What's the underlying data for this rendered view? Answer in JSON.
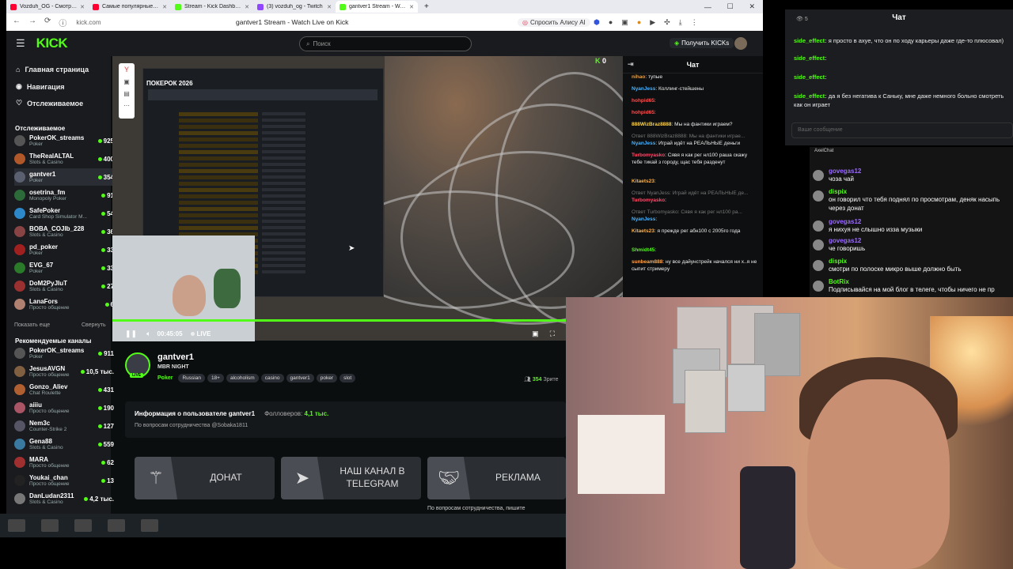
{
  "browser": {
    "tabs": [
      {
        "title": "Vozduh_OG - Смотрите в",
        "color": "#ff0033",
        "active": false
      },
      {
        "title": "Самые популярные трен",
        "color": "#ff0033",
        "active": false
      },
      {
        "title": "Stream - Kick Dashboard",
        "color": "#53fc18",
        "active": false
      },
      {
        "title": "(3) vozduh_og - Twitch",
        "color": "#9146ff",
        "active": false
      },
      {
        "title": "gantver1 Stream - Watc",
        "color": "#53fc18",
        "active": true
      }
    ],
    "url": "kick.com",
    "page_title": "gantver1 Stream - Watch Live on Kick",
    "alice": "Спросить Алису AI"
  },
  "kick": {
    "logo": "KICK",
    "search_placeholder": "Поиск",
    "get_kicks": "Получить KICKs",
    "sidebar": {
      "nav": [
        "Главная страница",
        "Навигация",
        "Отслеживаемое"
      ],
      "followed_title": "Отслеживаемое",
      "followed": [
        {
          "name": "PokerOK_streams",
          "cat": "Poker",
          "viewers": "925",
          "color": "#555"
        },
        {
          "name": "TheRealALTAL",
          "cat": "Slots & Casino",
          "viewers": "400",
          "color": "#b0582a"
        },
        {
          "name": "gantver1",
          "cat": "Poker",
          "viewers": "354",
          "color": "#5b6070"
        },
        {
          "name": "osetrina_fm",
          "cat": "Monopoly Poker",
          "viewers": "91",
          "color": "#2d6a3a"
        },
        {
          "name": "SafePoker",
          "cat": "Card Shop Simulator M...",
          "viewers": "54",
          "color": "#2d88c9"
        },
        {
          "name": "BOBA_COJIb_228",
          "cat": "Slots & Casino",
          "viewers": "36",
          "color": "#884444"
        },
        {
          "name": "pd_poker",
          "cat": "Poker",
          "viewers": "33",
          "color": "#a02020"
        },
        {
          "name": "EVG_67",
          "cat": "Poker",
          "viewers": "33",
          "color": "#2a7a2a"
        },
        {
          "name": "DoM2PyJIuT",
          "cat": "Slots & Casino",
          "viewers": "27",
          "color": "#9a3030"
        },
        {
          "name": "LanaFors",
          "cat": "Просто общение",
          "viewers": "6",
          "color": "#b08070"
        }
      ],
      "show_more": "Показать еще",
      "collapse": "Свернуть",
      "recommended_title": "Рекомендуемые каналы",
      "recommended": [
        {
          "name": "PokerOK_streams",
          "cat": "Poker",
          "viewers": "911",
          "color": "#555"
        },
        {
          "name": "JesusAVGN",
          "cat": "Просто общение",
          "viewers": "10,5 тыс.",
          "color": "#806040"
        },
        {
          "name": "Gonzo_Aliev",
          "cat": "Chat Roulette",
          "viewers": "431",
          "color": "#b06030"
        },
        {
          "name": "aiiiu",
          "cat": "Просто общение",
          "viewers": "190",
          "color": "#aa5566"
        },
        {
          "name": "Nem3c",
          "cat": "Counter-Strike 2",
          "viewers": "127",
          "color": "#556"
        },
        {
          "name": "Gena88",
          "cat": "Slots & Casino",
          "viewers": "559",
          "color": "#3a7aa0"
        },
        {
          "name": "MARA",
          "cat": "Просто общение",
          "viewers": "62",
          "color": "#a03030"
        },
        {
          "name": "Youkai_chan",
          "cat": "Просто общение",
          "viewers": "13",
          "color": "#222"
        },
        {
          "name": "DanLudan2311",
          "cat": "Slots & Casino",
          "viewers": "4,2 тыс.",
          "color": "#777"
        }
      ]
    },
    "player": {
      "overlay_title": "ПОКЕРОК 2026",
      "overlay_count": "0",
      "time": "00:45:05",
      "live": "LIVE"
    },
    "channel": {
      "name": "gantver1",
      "stream_title": "MBR NIGHT",
      "category": "Poker",
      "tags": [
        "Russian",
        "18+",
        "alcoholism",
        "casino",
        "gantver1",
        "poker",
        "slot"
      ],
      "viewers": "354",
      "viewers_label": "Зрите",
      "live_badge": "LIVE",
      "about_title": "Информация о пользователе gantver1",
      "followers_label": "Фолловеров:",
      "followers": "4,1 тыс.",
      "about_desc": "По вопросам сотрудничества @Sobaka1811",
      "panels": [
        "ДОНАТ",
        "НАШ КАНАЛ В TELEGRAM",
        "РЕКЛАМА"
      ],
      "panel_note": "По вопросам сотрудничества, пишите"
    },
    "chat": {
      "title": "Чат",
      "messages": [
        {
          "user": "nihao",
          "color": "#e0a050",
          "text": "тупые",
          "reply": ""
        },
        {
          "user": "NyanJess",
          "color": "#4ab3ff",
          "text": "Коллинг-стейшены",
          "reply": ""
        },
        {
          "user": "hohpid65",
          "color": "#ff5050",
          "text": "",
          "reply": ""
        },
        {
          "user": "hohpid65",
          "color": "#ff5050",
          "text": "",
          "reply": ""
        },
        {
          "user": "888WizBraz8888",
          "color": "#ffd34a",
          "text": "Мы на фантики играем?",
          "reply": ""
        },
        {
          "user": "NyanJess",
          "color": "#4ab3ff",
          "text": "Играй идёт на РЕАЛЬНЫЕ деньги",
          "reply": "Ответ 888WizBraz8888: Мы на фантики играе..."
        },
        {
          "user": "Turbomyasko",
          "color": "#ff4d6d",
          "text": "Сявя я как рег нл100 раша скажу тебе тикай з городу, щас тебя разденут",
          "reply": ""
        },
        {
          "user": "Kitaets23",
          "color": "#ffb04a",
          "text": "",
          "reply": ""
        },
        {
          "user": "Turbomyasko",
          "color": "#ff4d6d",
          "text": "",
          "reply": "Ответ NyanJess: Играй идёт на РЕАЛЬНЫЕ де..."
        },
        {
          "user": "NyanJess",
          "color": "#4ab3ff",
          "text": "",
          "reply": "Ответ Turbomyasko: Сявя я как рег нл100 ра..."
        },
        {
          "user": "Kitaets23",
          "color": "#ffb04a",
          "text": "я прежде рег абн100 с 2005го года",
          "reply": ""
        },
        {
          "user": "Shmidt45",
          "color": "#53fc18",
          "text": "",
          "reply": ""
        },
        {
          "user": "sunbeam888",
          "color": "#ffa94d",
          "text": "ну все дайунстрейк начался ни х..я не сыпит стримеру",
          "reply": ""
        }
      ]
    }
  },
  "right_chat": {
    "title": "Чат",
    "viewers": "5",
    "messages": [
      {
        "user": "side_effect:",
        "text": "я просто в ахуе, что он по ходу карьеры даже где-то плюсовал)"
      },
      {
        "user": "side_effect:",
        "text": ""
      },
      {
        "user": "side_effect:",
        "text": ""
      },
      {
        "user": "side_effect:",
        "text": "да я без негатива к Саньку, мне даже немного больно смотреть как он играет"
      }
    ],
    "input_placeholder": "Ваше сообщение"
  },
  "axel_chat": {
    "title": "AxelChat",
    "messages": [
      {
        "user": "govegas12",
        "color": "#9a6aff",
        "text": "чоза чай"
      },
      {
        "user": "dispix",
        "color": "#53fc18",
        "text": "он говорил что тебя поднял по просмотрам, деняк насыпь через донат"
      },
      {
        "user": "govegas12",
        "color": "#9a6aff",
        "text": "я нихуя не слышно изза музыки"
      },
      {
        "user": "govegas12",
        "color": "#9a6aff",
        "text": "че говоришь"
      },
      {
        "user": "dispix",
        "color": "#53fc18",
        "text": "смотри по полоске микро выше должно быть"
      },
      {
        "user": "BotRix",
        "color": "#53fc18",
        "text": "Подписывайся на мой блог в телеге, чтобы ничего не пр"
      }
    ]
  }
}
